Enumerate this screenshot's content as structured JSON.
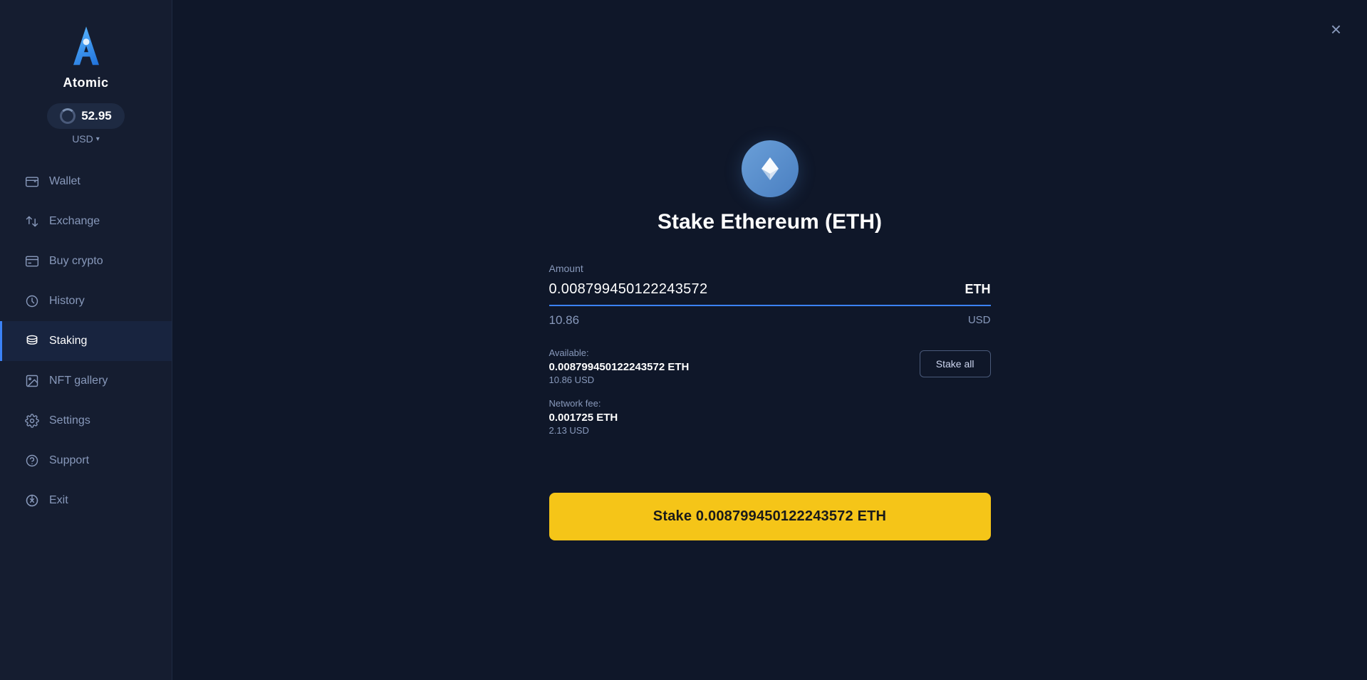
{
  "app": {
    "name": "Atomic"
  },
  "sidebar": {
    "balance": "52.95",
    "currency": "USD",
    "nav_items": [
      {
        "id": "wallet",
        "label": "Wallet",
        "icon": "wallet-icon",
        "active": false
      },
      {
        "id": "exchange",
        "label": "Exchange",
        "icon": "exchange-icon",
        "active": false
      },
      {
        "id": "buy-crypto",
        "label": "Buy crypto",
        "icon": "buy-crypto-icon",
        "active": false
      },
      {
        "id": "history",
        "label": "History",
        "icon": "history-icon",
        "active": false
      },
      {
        "id": "staking",
        "label": "Staking",
        "icon": "staking-icon",
        "active": true
      },
      {
        "id": "nft-gallery",
        "label": "NFT gallery",
        "icon": "nft-gallery-icon",
        "active": false
      },
      {
        "id": "settings",
        "label": "Settings",
        "icon": "settings-icon",
        "active": false
      },
      {
        "id": "support",
        "label": "Support",
        "icon": "support-icon",
        "active": false
      },
      {
        "id": "exit",
        "label": "Exit",
        "icon": "exit-icon",
        "active": false
      }
    ]
  },
  "stake_dialog": {
    "title": "Stake Ethereum (ETH)",
    "amount_label": "Amount",
    "amount_value": "0.008799450122243572",
    "amount_currency": "ETH",
    "amount_usd": "10.86",
    "amount_usd_currency": "USD",
    "available_label": "Available:",
    "available_eth": "0.008799450122243572 ETH",
    "available_usd": "10.86 USD",
    "network_fee_label": "Network fee:",
    "network_fee_eth": "0.001725 ETH",
    "network_fee_usd": "2.13 USD",
    "stake_all_label": "Stake all",
    "stake_button_label": "Stake 0.008799450122243572 ETH",
    "close_label": "×"
  }
}
